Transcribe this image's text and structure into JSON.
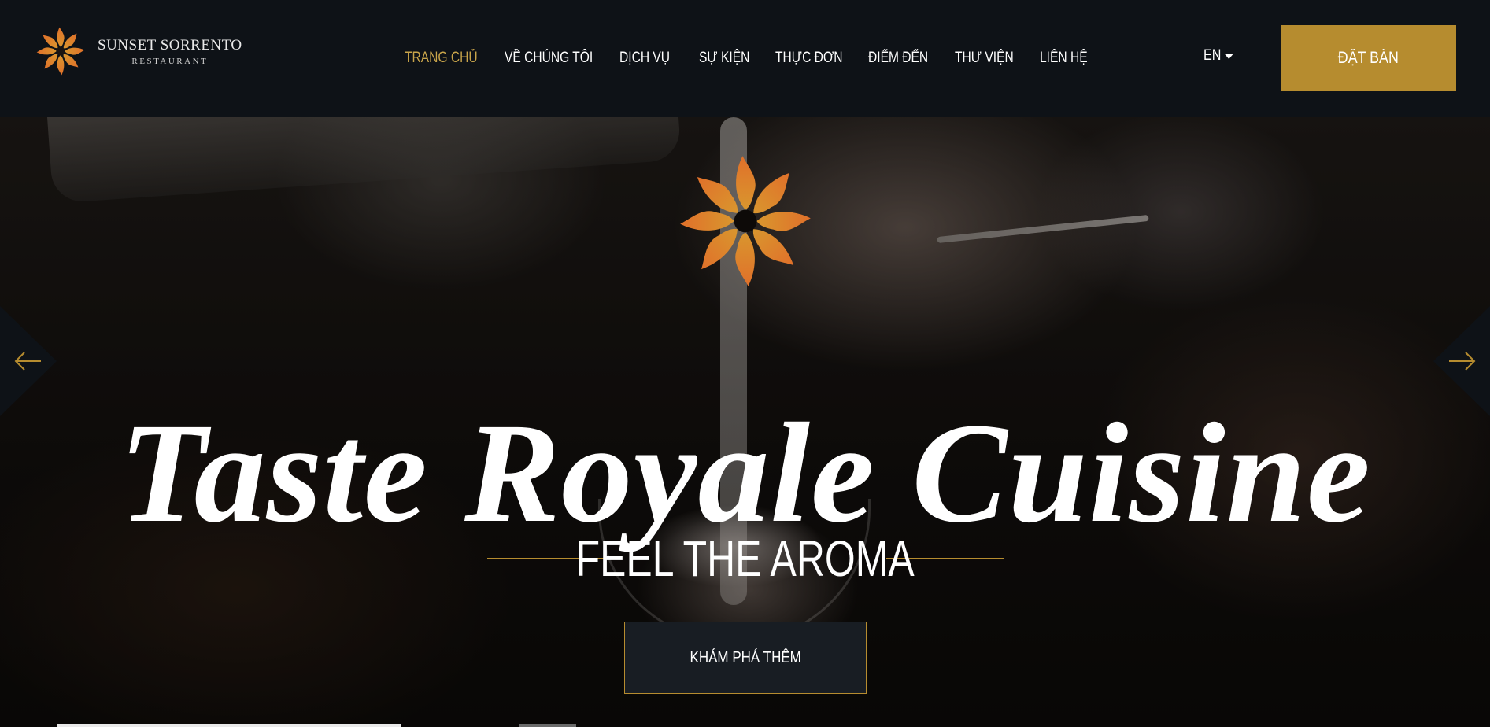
{
  "brand": {
    "name": "SUNSET SORRENTO",
    "tagline": "RESTAURANT",
    "logo_icon": "sun-star-icon"
  },
  "nav": {
    "items": [
      {
        "label": "TRANG CHỦ",
        "active": true
      },
      {
        "label": "VỀ CHÚNG TÔI",
        "active": false
      },
      {
        "label": "DỊCH VỤ",
        "active": false
      },
      {
        "label": "SỰ KIỆN",
        "active": false
      },
      {
        "label": "THỰC ĐƠN",
        "active": false
      },
      {
        "label": "ĐIỂM ĐẾN",
        "active": false
      },
      {
        "label": "THƯ VIỆN",
        "active": false
      },
      {
        "label": "LIÊN HỆ",
        "active": false
      }
    ],
    "language": "EN",
    "book_button": "ĐẶT BÀN"
  },
  "hero": {
    "title": "Taste Royale Cuisine",
    "subtitle": "FEEL THE AROMA",
    "cta": "KHÁM PHÁ THÊM",
    "prev_icon": "arrow-left-icon",
    "next_icon": "arrow-right-icon",
    "slider_progress": 0.25
  },
  "colors": {
    "accent": "#b68c2f",
    "active_nav": "#c8a44a",
    "header_bg": "#0e1217",
    "emblem_orange": "#e0702a",
    "emblem_gold": "#d9962e"
  }
}
